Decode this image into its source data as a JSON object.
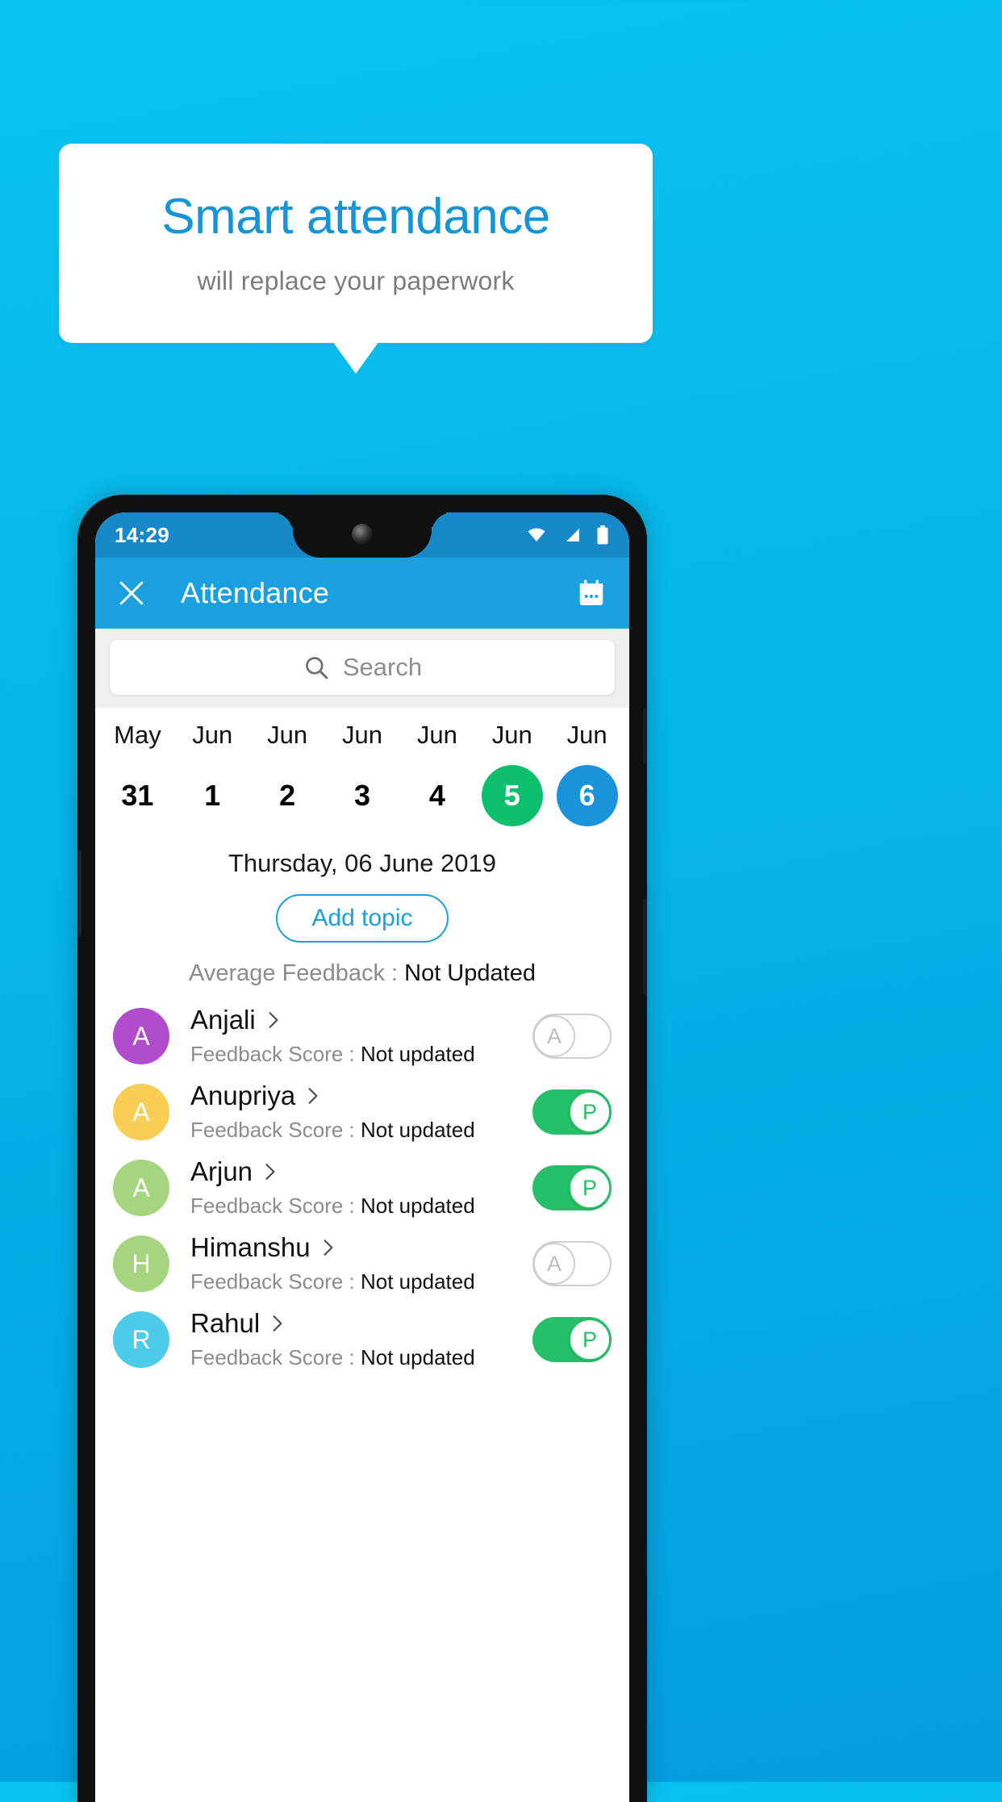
{
  "promo": {
    "title": "Smart attendance",
    "subtitle": "will replace your paperwork",
    "title_color": "#1595d8",
    "subtitle_color": "#7d7d7d"
  },
  "background": {
    "top_color": "#0ac4f0",
    "bottom_color": "#039de0"
  },
  "phone": {
    "status_bar": {
      "time": "14:29",
      "icons": [
        "wifi-icon",
        "signal-icon",
        "battery-icon"
      ],
      "background": "#1789c8"
    },
    "app_bar": {
      "close_label": "close-icon",
      "title": "Attendance",
      "calendar_label": "calendar-icon",
      "background": "#1aa0de"
    },
    "search": {
      "placeholder": "Search",
      "value": ""
    },
    "dates": [
      {
        "month": "May",
        "day": "31",
        "state": "none"
      },
      {
        "month": "Jun",
        "day": "1",
        "state": "none"
      },
      {
        "month": "Jun",
        "day": "2",
        "state": "none"
      },
      {
        "month": "Jun",
        "day": "3",
        "state": "none"
      },
      {
        "month": "Jun",
        "day": "4",
        "state": "none"
      },
      {
        "month": "Jun",
        "day": "5",
        "state": "green"
      },
      {
        "month": "Jun",
        "day": "6",
        "state": "blue"
      }
    ],
    "selected_date_label": "Thursday, 06 June 2019",
    "add_topic_label": "Add topic",
    "average_feedback": {
      "label": "Average Feedback : ",
      "value": "Not Updated"
    },
    "feedback_label": "Feedback Score : ",
    "students": [
      {
        "name": "Anjali",
        "initial": "A",
        "avatar_color": "#b14ccd",
        "feedback": "Not updated",
        "status": "A",
        "present": false
      },
      {
        "name": "Anupriya",
        "initial": "A",
        "avatar_color": "#facd55",
        "feedback": "Not updated",
        "status": "P",
        "present": true
      },
      {
        "name": "Arjun",
        "initial": "A",
        "avatar_color": "#a6d57f",
        "feedback": "Not updated",
        "status": "P",
        "present": true
      },
      {
        "name": "Himanshu",
        "initial": "H",
        "avatar_color": "#a6d57f",
        "feedback": "Not updated",
        "status": "A",
        "present": false
      },
      {
        "name": "Rahul",
        "initial": "R",
        "avatar_color": "#4dcbe8",
        "feedback": "Not updated",
        "status": "P",
        "present": true
      }
    ],
    "accent_green": "#27c06a",
    "accent_blue": "#1b93db"
  }
}
